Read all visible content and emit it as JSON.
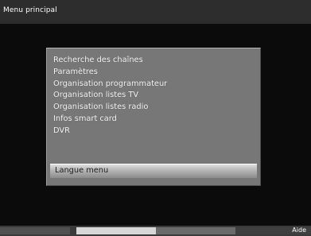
{
  "header": {
    "title": "Menu principal"
  },
  "menu": {
    "items": [
      "Recherche des chaînes",
      "Paramètres",
      "Organisation programmateur",
      "Organisation listes TV",
      "Organisation listes radio",
      "Infos smart card",
      "DVR"
    ],
    "selected": "Langue menu"
  },
  "footer": {
    "help_label": "Aide",
    "colors": {
      "red": "#505050",
      "green": "#d7d7d7",
      "yellow": "#6a6a6a",
      "blue": "#3f3f3f"
    }
  }
}
